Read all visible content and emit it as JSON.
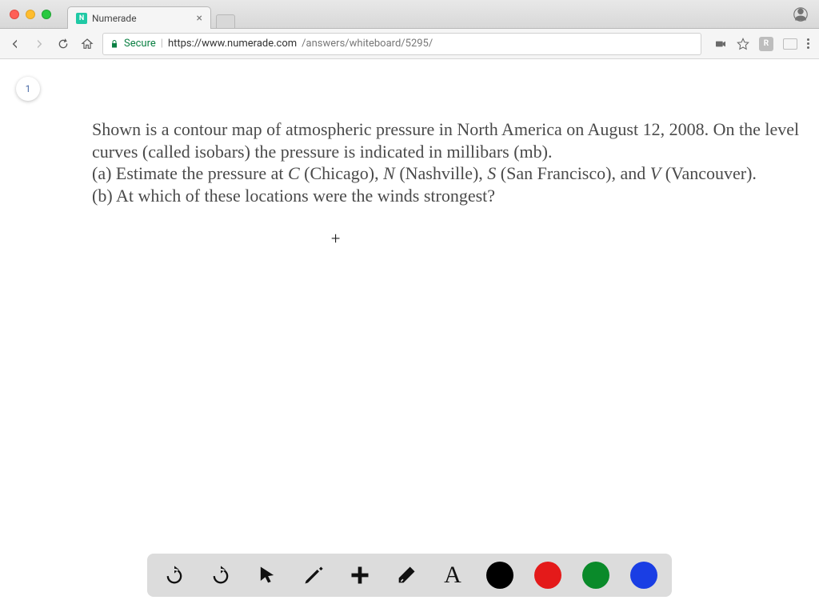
{
  "window": {
    "tab_title": "Numerade",
    "favicon_letter": "N"
  },
  "toolbar": {
    "secure_label": "Secure",
    "url_scheme_host": "https://www.numerade.com",
    "url_path": "/answers/whiteboard/5295/",
    "ext_badge": "R"
  },
  "page": {
    "badge": "1",
    "question_intro_a": "Shown is a contour map of atmospheric pressure in North America on August 12, 2008. On the level curves (called isobars) the pressure is indicated in millibars (mb).",
    "question_a_prefix": "(a) Estimate the pressure at ",
    "city_c_var": "C",
    "city_c_label": " (Chicago), ",
    "city_n_var": "N",
    "city_n_label": " (Nashville), ",
    "city_s_var": "S",
    "city_s_label": " (San Francisco), and ",
    "city_v_var": "V",
    "city_v_label": " (Vancouver).",
    "question_b": "(b) At which of these locations were the winds strongest?",
    "cursor": "+"
  },
  "whiteboard": {
    "tools": {
      "undo": "undo",
      "redo": "redo",
      "pointer": "pointer",
      "pencil": "pencil",
      "plus": "plus",
      "eraser": "eraser",
      "text": "A"
    },
    "colors": {
      "black": "#000000",
      "red": "#e41a1a",
      "green": "#0a8a2a",
      "blue": "#1a3ee4"
    }
  }
}
